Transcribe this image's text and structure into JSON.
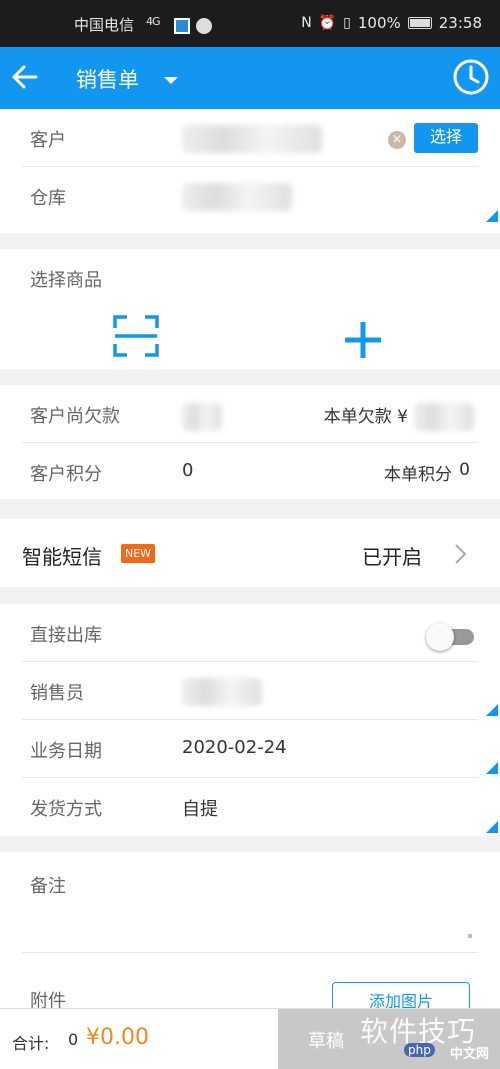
{
  "status_bar": {
    "carrier": "中国电信",
    "signal": "4G",
    "battery": "100%",
    "time": "23:58"
  },
  "header": {
    "title": "销售单"
  },
  "customer_section": {
    "customer_label": "客户",
    "select_button": "选择",
    "warehouse_label": "仓库"
  },
  "goods_section": {
    "title": "选择商品"
  },
  "debt_section": {
    "customer_debt_label": "客户尚欠款",
    "order_debt_label": "本单欠款 ¥",
    "customer_points_label": "客户积分",
    "customer_points_value": "0",
    "order_points_label": "本单积分",
    "order_points_value": "0"
  },
  "sms_section": {
    "label": "智能短信",
    "badge": "NEW",
    "status": "已开启"
  },
  "details_section": {
    "direct_out_label": "直接出库",
    "direct_out_enabled": false,
    "salesperson_label": "销售员",
    "date_label": "业务日期",
    "date_value": "2020-02-24",
    "delivery_label": "发货方式",
    "delivery_value": "自提"
  },
  "remark_section": {
    "remark_label": "备注",
    "attachment_label": "附件",
    "add_image_button": "添加图片"
  },
  "bottom_bar": {
    "total_label": "合计:",
    "total_count": "0",
    "total_amount": "¥0.00",
    "draft_button": "草稿"
  },
  "watermark": {
    "text": "软件技巧",
    "logo": "php",
    "site": "中文网"
  },
  "colors": {
    "primary": "#1296f0",
    "accent_orange": "#f08c1a",
    "badge_orange": "#f06a1c"
  }
}
